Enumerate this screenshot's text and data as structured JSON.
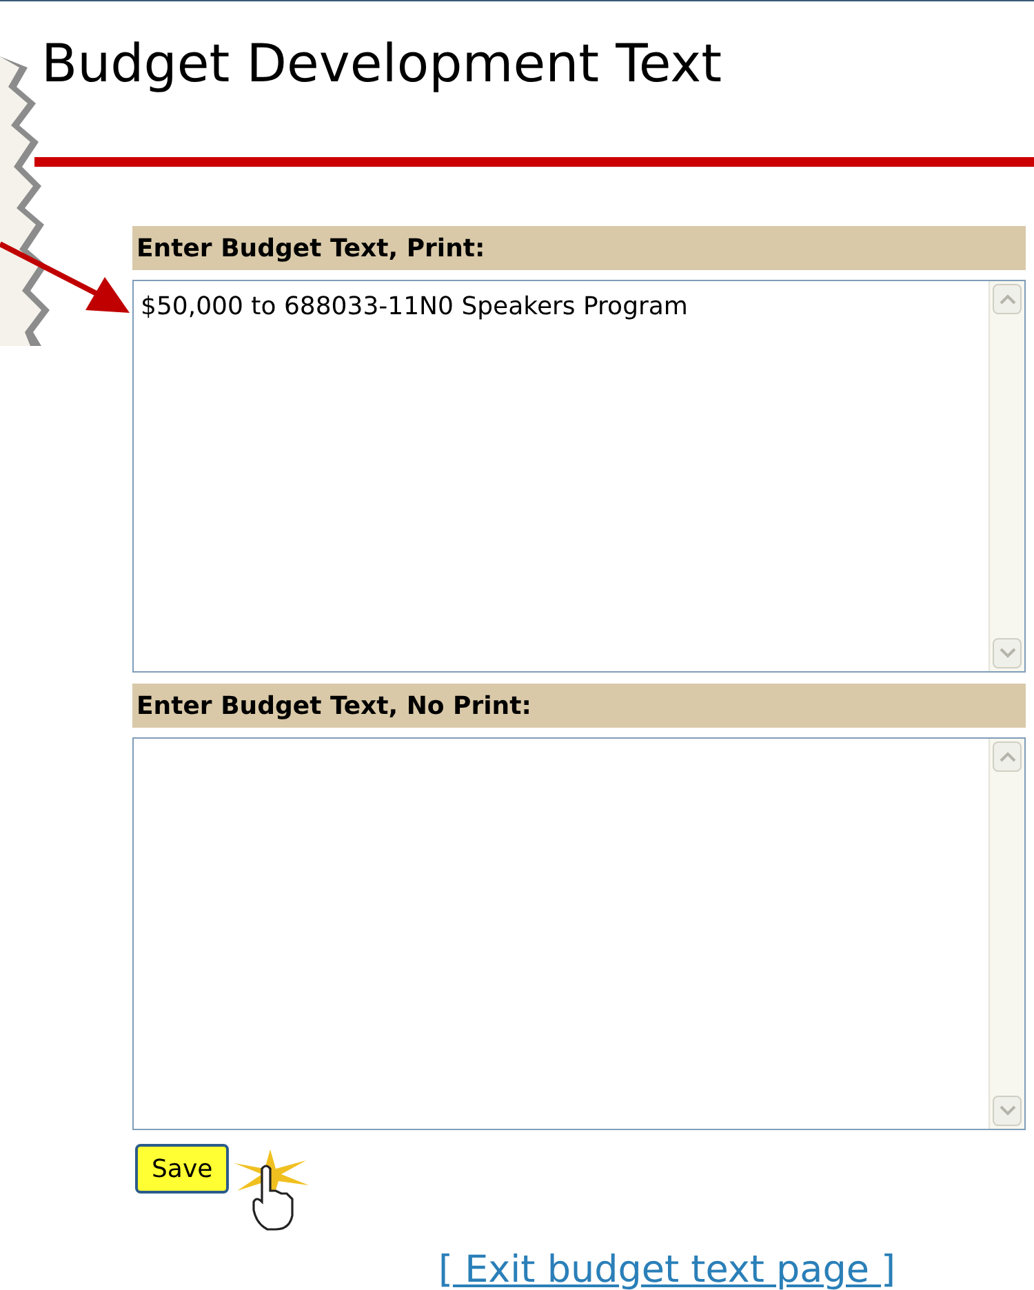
{
  "page": {
    "title": "Budget Development Text"
  },
  "sections": [
    {
      "label": "Enter Budget Text, Print:",
      "value": "$50,000 to 688033-11N0 Speakers Program"
    },
    {
      "label": "Enter Budget Text, No Print:"
    }
  ],
  "save_button": {
    "label": "Save"
  },
  "exit_link": {
    "label": "[ Exit budget text page ]"
  }
}
